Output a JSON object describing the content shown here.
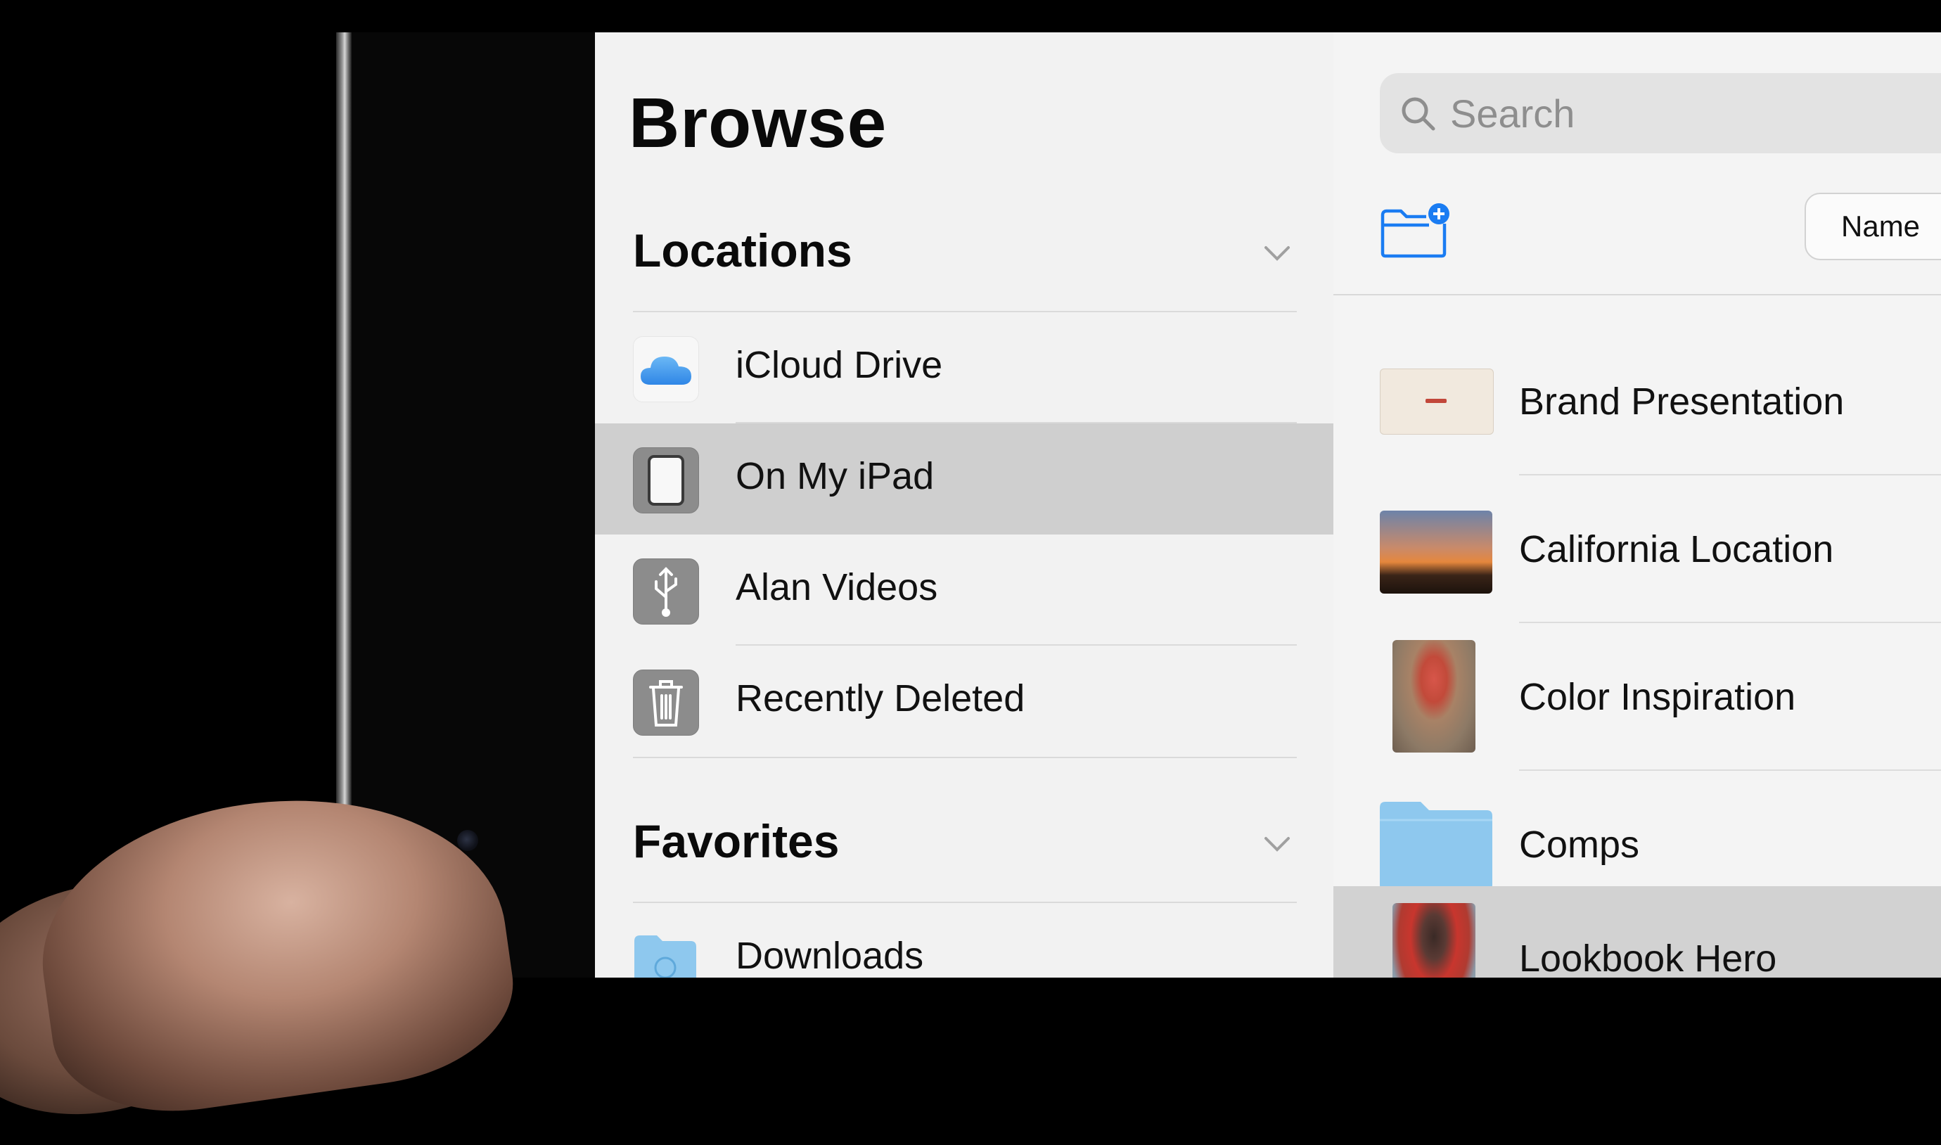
{
  "sidebar": {
    "title": "Browse",
    "locations": {
      "header": "Locations",
      "items": [
        {
          "label": "iCloud Drive",
          "icon": "cloud-icon"
        },
        {
          "label": "On My iPad",
          "icon": "ipad-icon",
          "selected": true
        },
        {
          "label": "Alan Videos",
          "icon": "usb-icon"
        },
        {
          "label": "Recently Deleted",
          "icon": "trash-icon"
        }
      ]
    },
    "favorites": {
      "header": "Favorites",
      "items": [
        {
          "label": "Downloads",
          "icon": "downloads-folder-icon"
        }
      ]
    }
  },
  "main": {
    "search": {
      "placeholder": "Search"
    },
    "sort_label": "Name",
    "files": [
      {
        "name": "Brand Presentation",
        "thumb": "presentation-thumbnail"
      },
      {
        "name": "California Location",
        "thumb": "sunset-photo-thumbnail"
      },
      {
        "name": "Color Inspiration",
        "thumb": "flower-photo-thumbnail"
      },
      {
        "name": "Comps",
        "thumb": "folder-icon"
      },
      {
        "name": "Lookbook Hero",
        "thumb": "portrait-photo-thumbnail",
        "selected": true
      }
    ]
  },
  "colors": {
    "accent": "#1a7cf2",
    "sidebar_bg": "#f2f2f2",
    "selection": "#cfcfcf",
    "folder": "#8ec8ee"
  }
}
